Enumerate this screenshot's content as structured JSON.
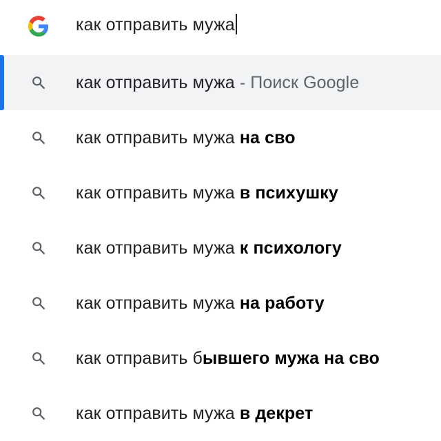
{
  "input": {
    "value": "как отправить мужа",
    "icon": "google-g-logo"
  },
  "colors": {
    "selected_bg": "#f1f3f4",
    "selected_bar": "#1a73e8",
    "text": "#202124",
    "muted": "#5f6368"
  },
  "suggestions": [
    {
      "prefix": "как отправить мужа",
      "bold": "",
      "suffix": " - Поиск Google",
      "icon": "search-icon",
      "selected": true
    },
    {
      "prefix": "как отправить мужа ",
      "bold": "на сво",
      "suffix": "",
      "icon": "search-icon",
      "selected": false
    },
    {
      "prefix": "как отправить мужа ",
      "bold": "в психушку",
      "suffix": "",
      "icon": "search-icon",
      "selected": false
    },
    {
      "prefix": "как отправить мужа ",
      "bold": "к психологу",
      "suffix": "",
      "icon": "search-icon",
      "selected": false
    },
    {
      "prefix": "как отправить мужа ",
      "bold": "на работу",
      "suffix": "",
      "icon": "search-icon",
      "selected": false
    },
    {
      "prefix": "как отправить б",
      "bold": "ывшего мужа на сво",
      "suffix": "",
      "icon": "search-icon",
      "selected": false
    },
    {
      "prefix": "как отправить мужа ",
      "bold": "в декрет",
      "suffix": "",
      "icon": "search-icon",
      "selected": false
    }
  ]
}
